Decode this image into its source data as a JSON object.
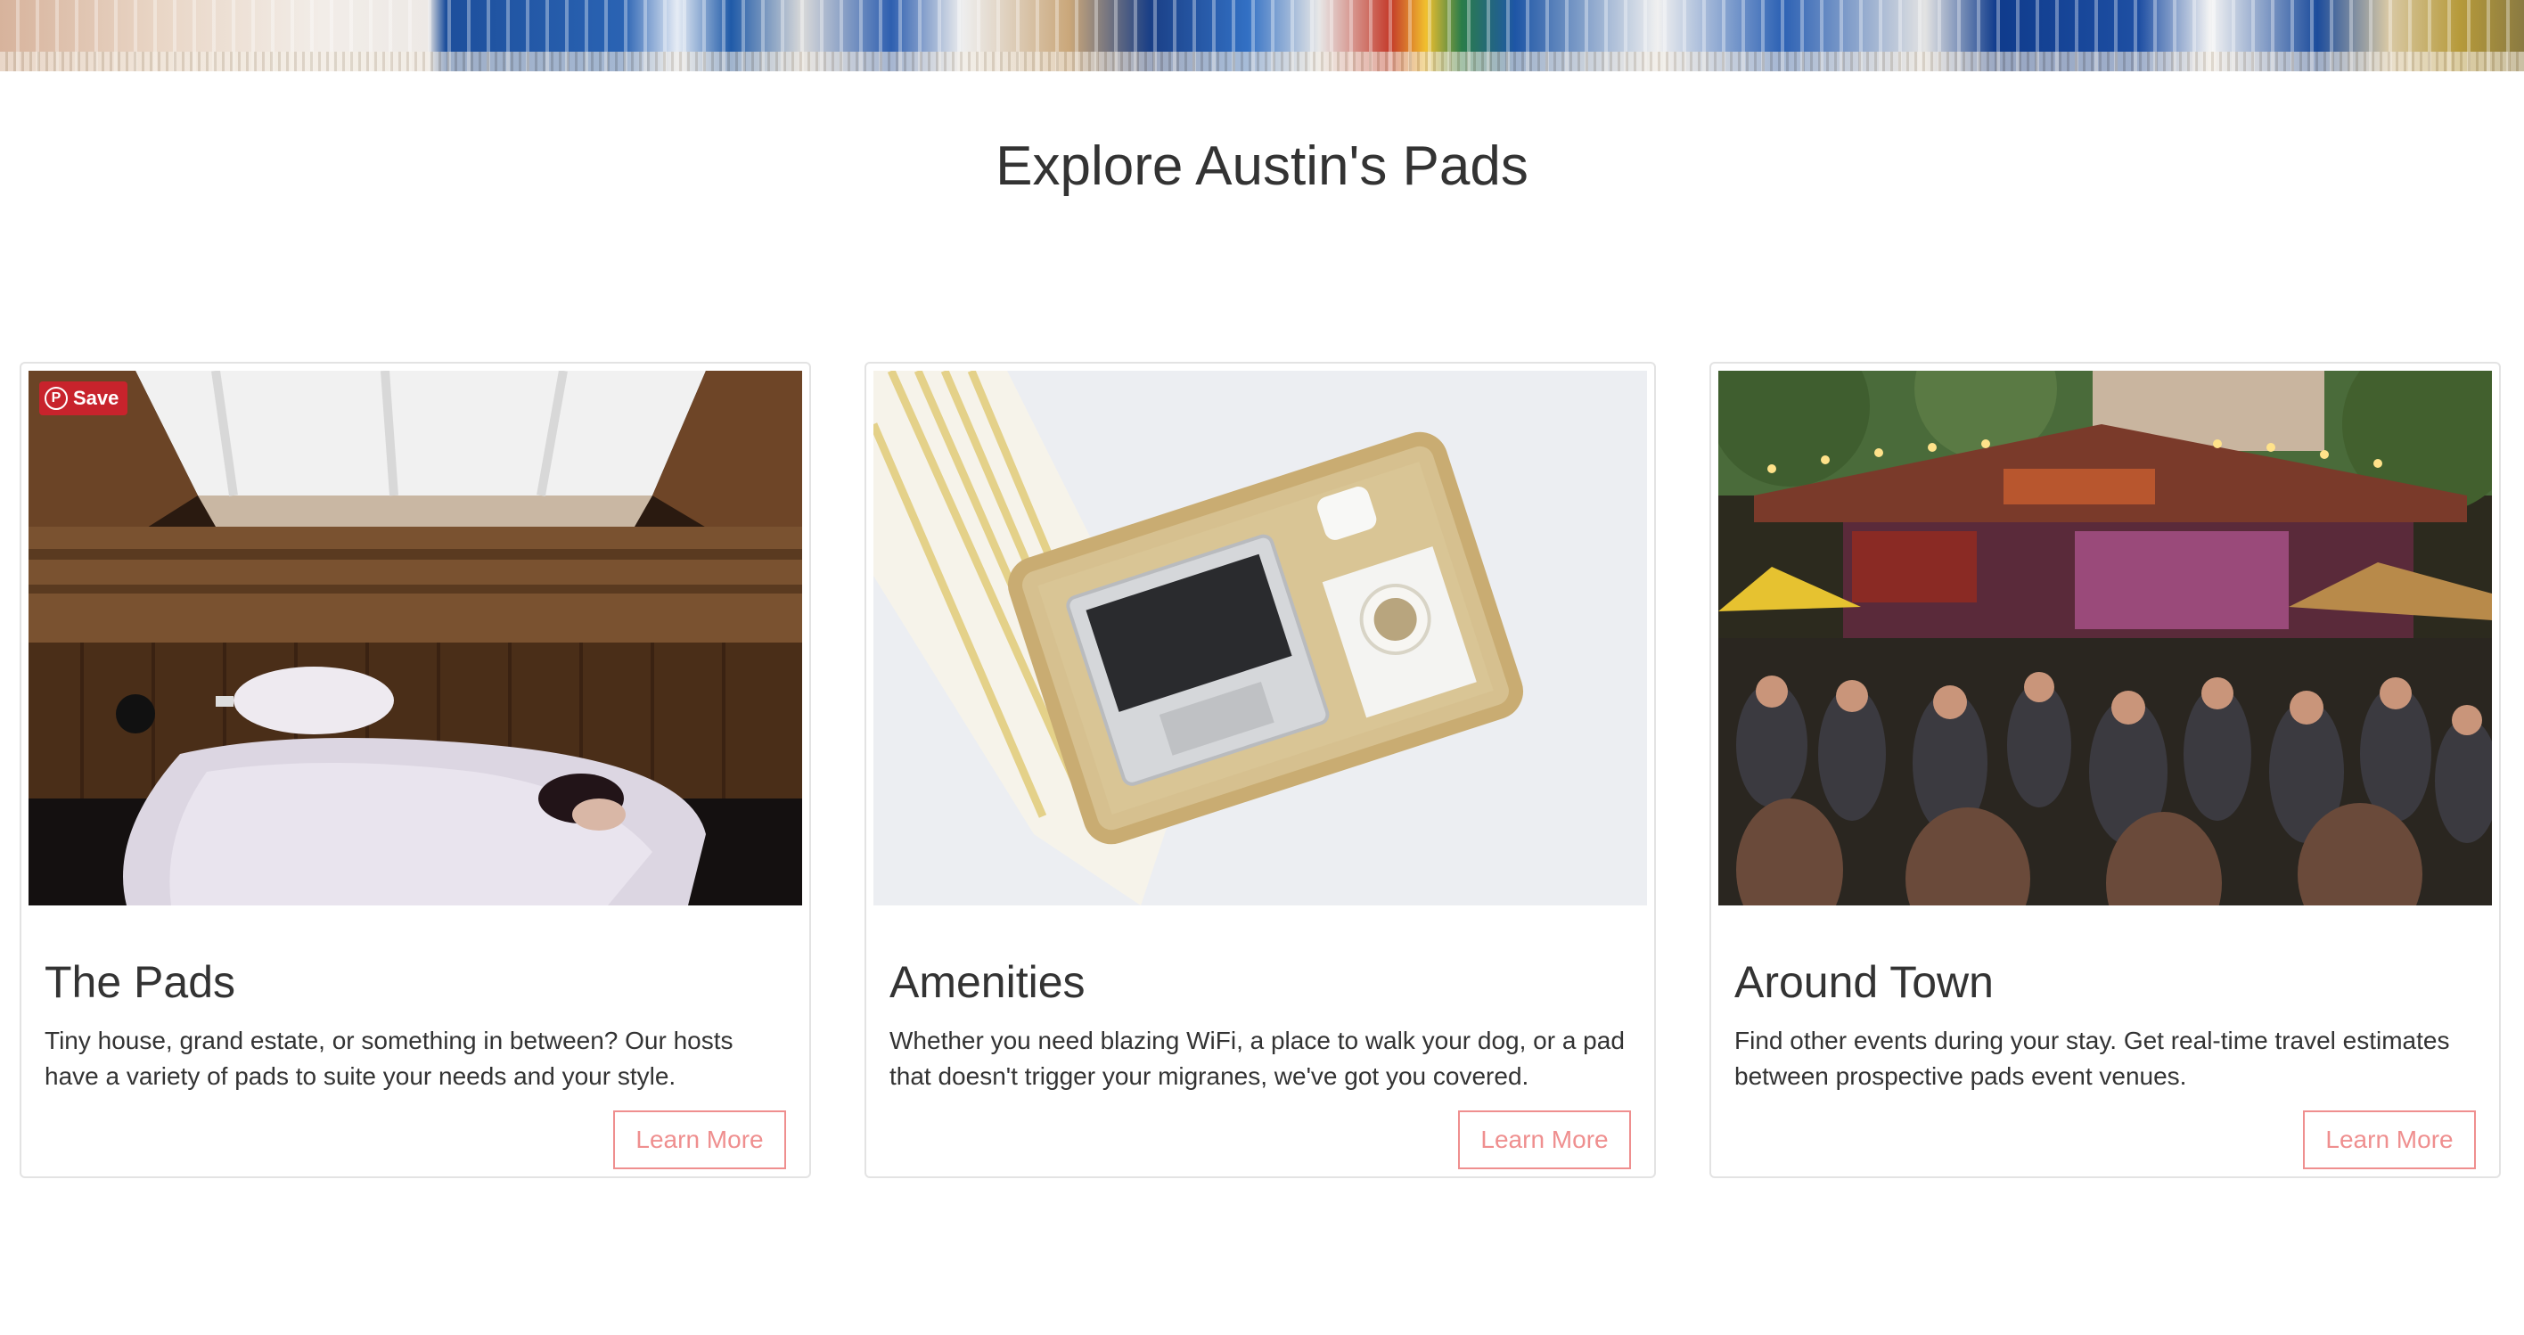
{
  "section": {
    "title": "Explore Austin's Pads"
  },
  "pinterest": {
    "save_label": "Save",
    "icon": "pinterest-icon"
  },
  "cards": [
    {
      "title": "The Pads",
      "text": "Tiny house, grand estate, or something in between? Our hosts have a variety of pads to suite your needs and your style.",
      "button": "Learn More",
      "image": "bedroom-attic-photo"
    },
    {
      "title": "Amenities",
      "text": "Whether you need blazing WiFi, a place to walk your dog, or a pad that doesn't trigger your migranes, we've got you covered.",
      "button": "Learn More",
      "image": "laptop-tray-photo"
    },
    {
      "title": "Around Town",
      "text": "Find other events during your stay. Get real-time travel estimates between prospective pads event venues.",
      "button": "Learn More",
      "image": "outdoor-concert-photo"
    }
  ],
  "colors": {
    "accent": "#ef8f8f",
    "pinterest": "#c8232c",
    "text": "#333333"
  }
}
